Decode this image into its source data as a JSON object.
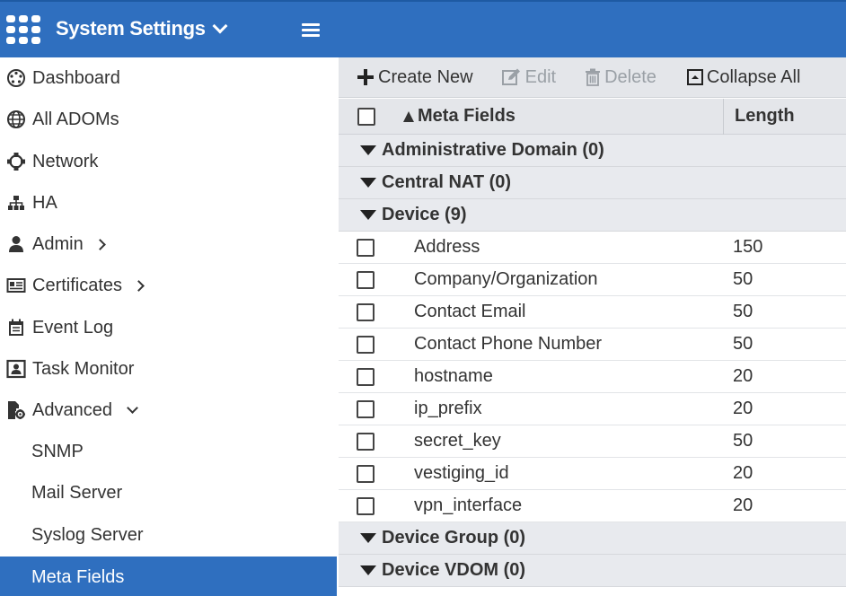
{
  "header": {
    "app_title": "System Settings",
    "logo_icon": "fortinet-grid-icon",
    "menu_icon": "hamburger-icon",
    "color": "#2f6fbf"
  },
  "sidebar": {
    "items": [
      {
        "label": "Dashboard",
        "icon": "dashboard-icon"
      },
      {
        "label": "All ADOMs",
        "icon": "globe-icon"
      },
      {
        "label": "Network",
        "icon": "network-icon"
      },
      {
        "label": "HA",
        "icon": "ha-icon"
      },
      {
        "label": "Admin",
        "icon": "user-icon"
      },
      {
        "label": "Certificates",
        "icon": "certificate-icon"
      },
      {
        "label": "Event Log",
        "icon": "event-log-icon"
      },
      {
        "label": "Task Monitor",
        "icon": "task-monitor-icon"
      },
      {
        "label": "Advanced",
        "icon": "advanced-icon"
      }
    ],
    "sub_items": [
      {
        "label": "SNMP"
      },
      {
        "label": "Mail Server"
      },
      {
        "label": "Syslog Server"
      },
      {
        "label": "Meta Fields",
        "active": true
      }
    ]
  },
  "toolbar": {
    "create_new": "Create New",
    "edit": "Edit",
    "delete": "Delete",
    "collapse_all": "Collapse All"
  },
  "table": {
    "columns": [
      "Meta Fields",
      "Length"
    ],
    "sort": "ascending",
    "groups_before": [
      {
        "label": "Administrative Domain (0)"
      },
      {
        "label": "Central NAT (0)"
      },
      {
        "label": "Device (9)"
      }
    ],
    "rows": [
      {
        "name": "Address",
        "length": "150"
      },
      {
        "name": "Company/Organization",
        "length": "50"
      },
      {
        "name": "Contact Email",
        "length": "50"
      },
      {
        "name": "Contact Phone Number",
        "length": "50"
      },
      {
        "name": "hostname",
        "length": "20"
      },
      {
        "name": "ip_prefix",
        "length": "20"
      },
      {
        "name": "secret_key",
        "length": "50"
      },
      {
        "name": "vestiging_id",
        "length": "20"
      },
      {
        "name": "vpn_interface",
        "length": "20"
      }
    ],
    "groups_after": [
      {
        "label": "Device Group (0)"
      },
      {
        "label": "Device VDOM (0)"
      }
    ]
  }
}
